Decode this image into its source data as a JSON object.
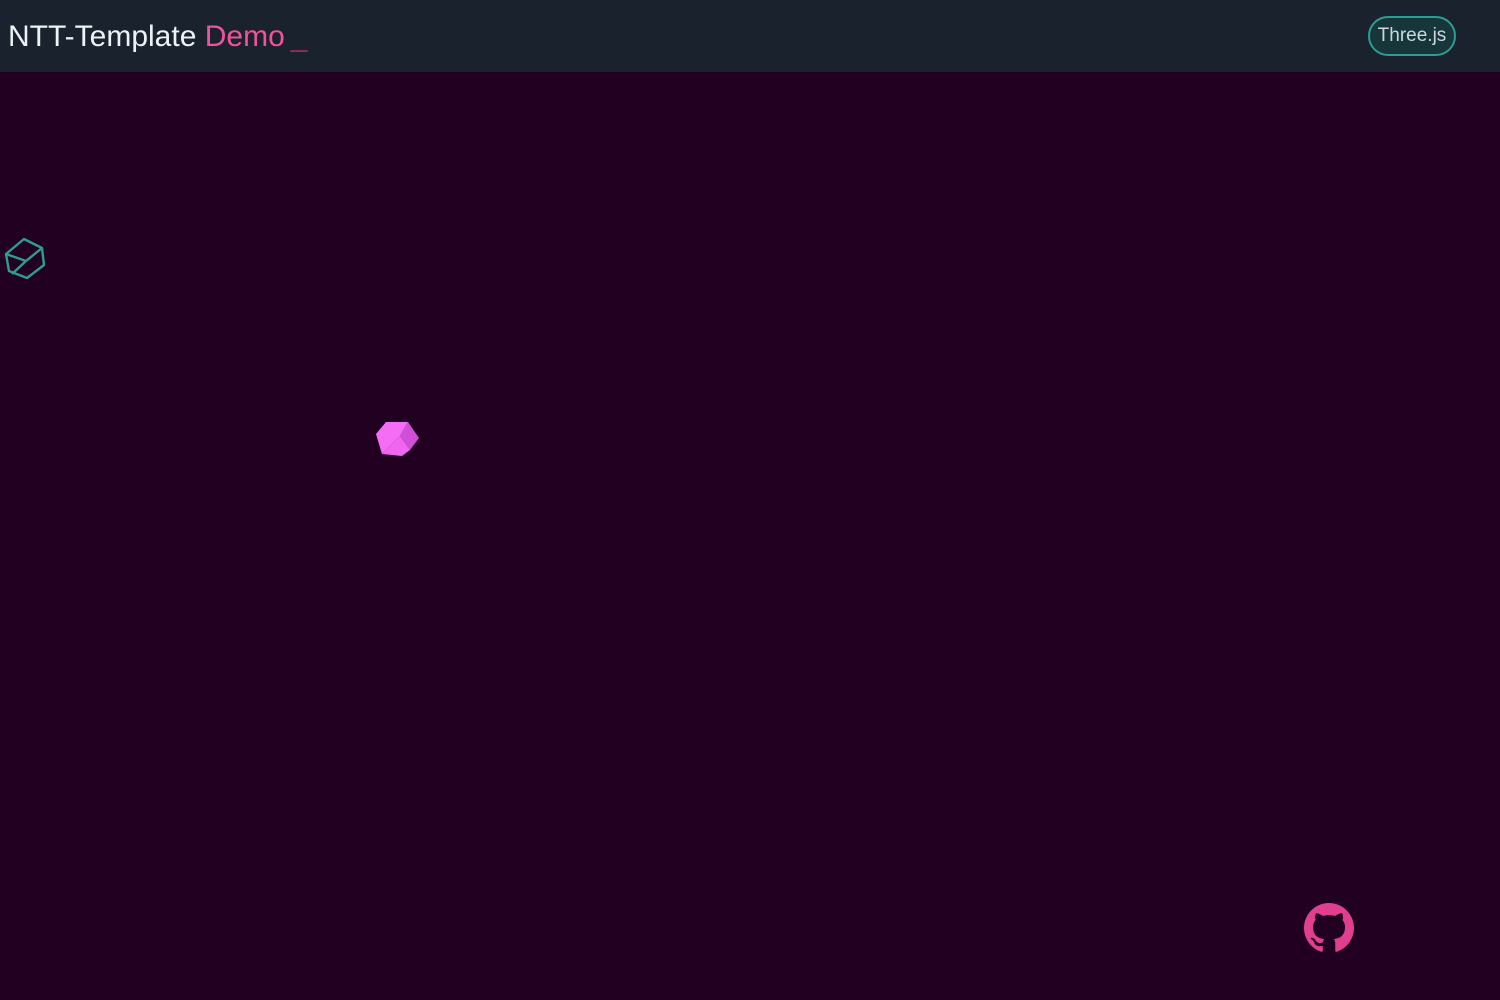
{
  "header": {
    "title_main": "NTT-Template",
    "title_accent": "Demo",
    "title_cursor": "_",
    "tag_label": "Three.js"
  },
  "scene": {
    "objects": [
      {
        "name": "wireframe-cube",
        "color": "#2d9c95"
      },
      {
        "name": "solid-cube",
        "color": "#f060f0"
      }
    ]
  },
  "footer": {
    "github_icon": "github-icon",
    "github_color": "#e03f8f"
  },
  "colors": {
    "background": "#220022",
    "header_bg": "#1a222e",
    "accent_pink": "#f0529c",
    "accent_teal": "#2d9c95"
  }
}
